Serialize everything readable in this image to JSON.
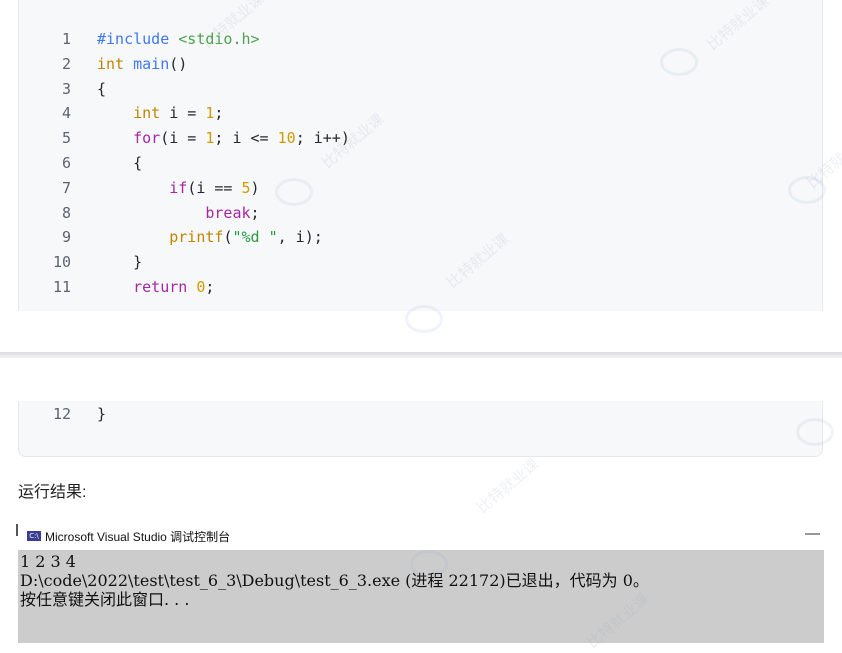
{
  "code": {
    "lines": [
      {
        "n": "1",
        "src": [
          {
            "t": "#include ",
            "c": "pre"
          },
          {
            "t": "<stdio.h>",
            "c": "inc"
          }
        ]
      },
      {
        "n": "2",
        "src": [
          {
            "t": "int",
            "c": "ty"
          },
          {
            "t": " "
          },
          {
            "t": "main",
            "c": "fn"
          },
          {
            "t": "()"
          }
        ]
      },
      {
        "n": "3",
        "src": [
          {
            "t": "{"
          }
        ]
      },
      {
        "n": "4",
        "src": [
          {
            "t": "    "
          },
          {
            "t": "int",
            "c": "ty"
          },
          {
            "t": " i = "
          },
          {
            "t": "1",
            "c": "num"
          },
          {
            "t": ";"
          }
        ]
      },
      {
        "n": "5",
        "src": [
          {
            "t": "    "
          },
          {
            "t": "for",
            "c": "kw"
          },
          {
            "t": "(i = "
          },
          {
            "t": "1",
            "c": "num"
          },
          {
            "t": "; i <= "
          },
          {
            "t": "10",
            "c": "num"
          },
          {
            "t": "; i++)"
          }
        ]
      },
      {
        "n": "6",
        "src": [
          {
            "t": "    {"
          }
        ]
      },
      {
        "n": "7",
        "src": [
          {
            "t": "        "
          },
          {
            "t": "if",
            "c": "kw"
          },
          {
            "t": "(i == "
          },
          {
            "t": "5",
            "c": "num"
          },
          {
            "t": ")"
          }
        ]
      },
      {
        "n": "8",
        "src": [
          {
            "t": "            "
          },
          {
            "t": "break",
            "c": "kw"
          },
          {
            "t": ";"
          }
        ]
      },
      {
        "n": "9",
        "src": [
          {
            "t": "        "
          },
          {
            "t": "printf",
            "c": "ty"
          },
          {
            "t": "("
          },
          {
            "t": "\"%d \"",
            "c": "str"
          },
          {
            "t": ", i);"
          }
        ]
      },
      {
        "n": "10",
        "src": [
          {
            "t": "    }"
          }
        ]
      },
      {
        "n": "11",
        "src": [
          {
            "t": "    "
          },
          {
            "t": "return",
            "c": "kw"
          },
          {
            "t": " "
          },
          {
            "t": "0",
            "c": "num"
          },
          {
            "t": ";"
          }
        ]
      }
    ],
    "continued_lines": [
      {
        "n": "12",
        "src": [
          {
            "t": "}"
          }
        ]
      }
    ]
  },
  "result_label": "运行结果:",
  "console": {
    "title": "Microsoft Visual Studio 调试控制台",
    "icon_text": "C:\\",
    "minimize_glyph": "—",
    "output": [
      "1 2 3 4",
      "D:\\code\\2022\\test\\test_6_3\\Debug\\test_6_3.exe (进程 22172)已退出，代码为 0。",
      "按任意键关闭此窗口. . ."
    ]
  },
  "watermark": "比特就业课"
}
